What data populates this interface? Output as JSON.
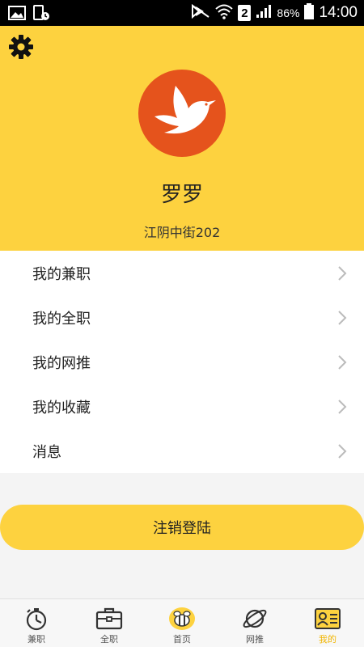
{
  "status_bar": {
    "battery": "86%",
    "sim": "2",
    "time": "14:00"
  },
  "header": {
    "user_name": "罗罗",
    "address": "江阴中街202"
  },
  "menu": {
    "items": [
      {
        "label": "我的兼职"
      },
      {
        "label": "我的全职"
      },
      {
        "label": "我的网推"
      },
      {
        "label": "我的收藏"
      },
      {
        "label": "消息"
      }
    ]
  },
  "logout": {
    "label": "注销登陆"
  },
  "bottom_nav": {
    "items": [
      {
        "label": "兼职"
      },
      {
        "label": "全职"
      },
      {
        "label": "首页"
      },
      {
        "label": "网推"
      },
      {
        "label": "我的"
      }
    ],
    "active": "我的"
  },
  "colors": {
    "accent": "#fdd23f",
    "avatar_bg": "#e5531c",
    "active_tab": "#f1b500"
  }
}
